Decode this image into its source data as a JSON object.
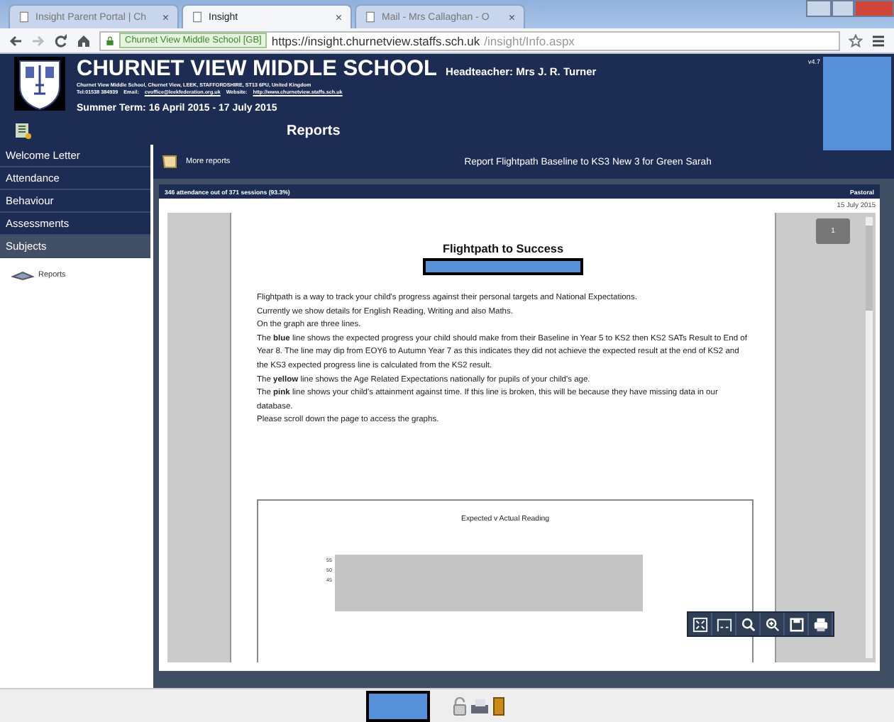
{
  "browser": {
    "tabs": [
      {
        "title": "Insight Parent Portal | Ch",
        "selected": false
      },
      {
        "title": "Insight",
        "selected": true
      },
      {
        "title": "Mail - Mrs Callaghan - O",
        "selected": false
      }
    ],
    "close_glyph": "×",
    "site_badge": "Churnet View Middle School [GB]",
    "url_host": "https://insight.churnetview.staffs.sch.uk",
    "url_path": "/insight/Info.aspx"
  },
  "header": {
    "school": "CHURNET VIEW MIDDLE SCHOOL",
    "headteacher": "Headteacher: Mrs J. R. Turner",
    "address": "Churnet View Middle School, Churnet View, LEEK, STAFFORDSHIRE, ST13 6PU, United Kingdom",
    "tel": "Tel:01538 384939",
    "email_label": "Email:",
    "email": "cvoffice@leekfederation.org.uk",
    "website_label": "Website:",
    "website": "http://www.churnetview.staffs.sch.uk",
    "term": "Summer Term: 16 April 2015 - 17 July 2015",
    "version": "v4.7",
    "page_title": "Reports"
  },
  "sidebar": {
    "items": [
      {
        "label": "Welcome Letter",
        "selected": false
      },
      {
        "label": "Attendance",
        "selected": false
      },
      {
        "label": "Behaviour",
        "selected": false
      },
      {
        "label": "Assessments",
        "selected": false
      },
      {
        "label": "Subjects",
        "selected": true
      }
    ],
    "sub_items": [
      "Reports"
    ]
  },
  "toolbar": {
    "more_reports": "More reports",
    "report_title": "Report Flightpath Baseline to KS3 New 3 for Green Sarah"
  },
  "status_strip": {
    "attendance": "346 attendance out of 371 sessions (93.3%)",
    "section": "Pastoral"
  },
  "viewer": {
    "date": "15 July 2015",
    "page_number": "1",
    "document": {
      "title": "Flightpath to Success",
      "paragraphs": [
        "Flightpath is a way to track your child's progress against their personal targets and National Expectations.",
        "Currently we show details for English Reading, Writing and also Maths.",
        "On the graph are three lines.",
        "The **blue** line shows the expected progress your child should make from their Baseline in Year 5  to KS2 then KS2 SATs Result to End of Year 8.  The line may dip from EOY6 to Autumn Year 7 as this indicates they did not achieve the expected result at the end of KS2 and the KS3 expected progress line is calculated from the KS2 result.",
        "The **yellow** line shows the Age Related Expectations nationally for pupils of your child's age.",
        "The **pink** line shows your child's attainment against time.  If this line is broken, this will be because they have missing data in our database.",
        "Please scroll down the page to access the graphs."
      ],
      "chart": {
        "title": "Expected v Actual Reading",
        "y_tick_labels": [
          "55",
          "50",
          "45"
        ]
      }
    }
  }
}
